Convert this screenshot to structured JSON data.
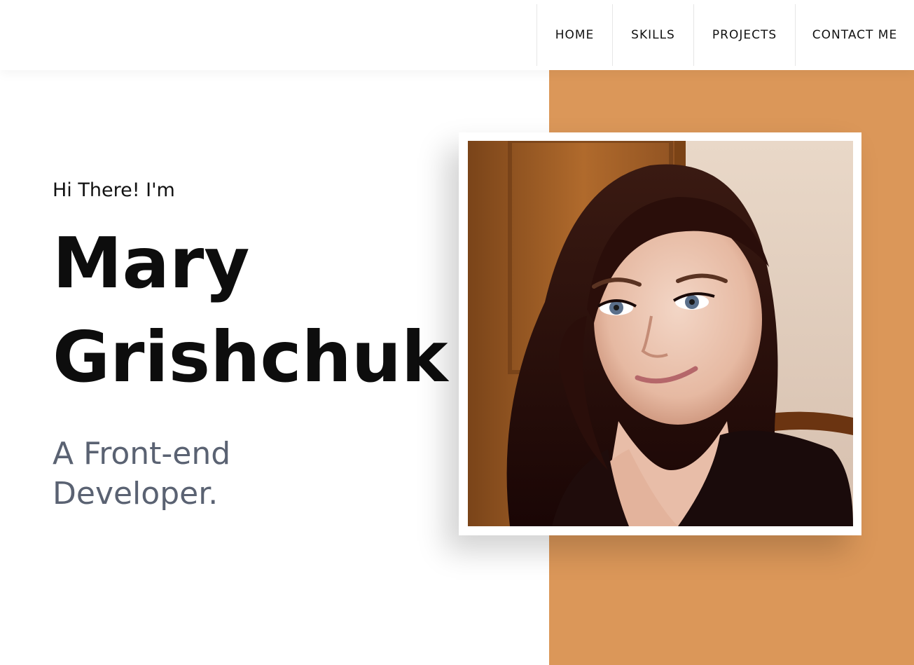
{
  "nav": {
    "items": [
      {
        "label": "HOME"
      },
      {
        "label": "SKILLS"
      },
      {
        "label": "PROJECTS"
      },
      {
        "label": "CONTACT ME"
      }
    ]
  },
  "hero": {
    "greeting": "Hi There! I'm",
    "first_name": "Mary",
    "last_name": "Grishchuk",
    "role": "A Front-end Developer."
  },
  "colors": {
    "accent": "#db9759",
    "name_text": "#0d0d0d",
    "role_text": "#5a6272"
  },
  "photo": {
    "subject": "portrait-photo"
  }
}
